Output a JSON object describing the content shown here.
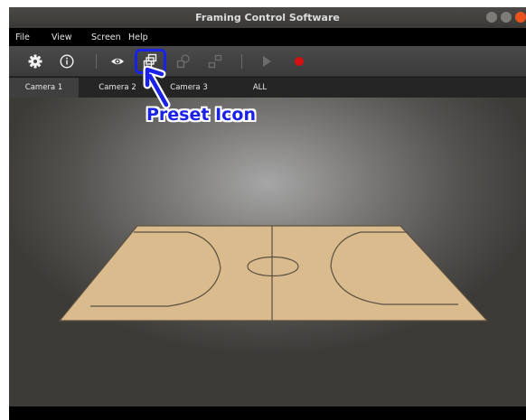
{
  "window": {
    "title": "Framing Control Software",
    "controls": {
      "minimize": "minimize-icon",
      "maximize": "maximize-icon",
      "close": "close-icon"
    }
  },
  "menu": {
    "file": "File",
    "view": "View",
    "screen": "Screen",
    "help": "Help"
  },
  "toolbar": {
    "icons": [
      "gear-icon",
      "info-icon",
      "eye-icon",
      "preset-icon",
      "preset-recall-icon",
      "preset-layout-icon",
      "play-icon",
      "record-icon"
    ],
    "record_color": "#d41010",
    "highlight_color": "#1a22e8"
  },
  "tabs": [
    "Camera 1",
    "Camera 2",
    "Camera 3",
    "ALL"
  ],
  "active_tab": "Camera 1",
  "annotation": {
    "label": "Preset Icon",
    "color": "#1a22e8"
  },
  "court": {
    "floor_color": "#d9bb8e",
    "line_color": "#5b5040"
  }
}
